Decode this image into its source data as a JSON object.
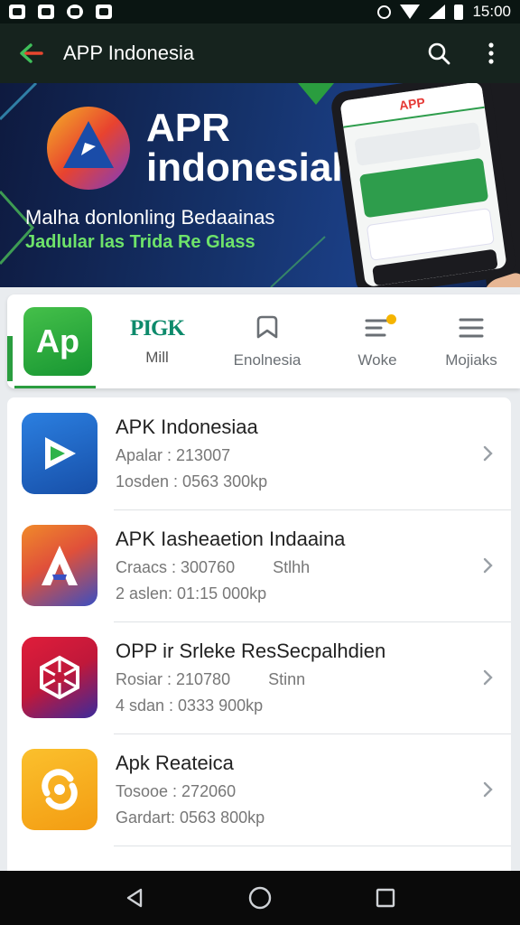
{
  "status_bar": {
    "time": "15:00"
  },
  "app_bar": {
    "title": "APP Indonesia"
  },
  "banner": {
    "title_line1": "APR",
    "title_line2": "indonesial",
    "subtitle": "Malha donlonling Bedaainas",
    "tagline": "Jadlular las Trida Re Glass",
    "phone_header": "APP",
    "colors": {
      "accent_green": "#6ee36a"
    }
  },
  "tabs": {
    "logo_text": "Ap",
    "items": [
      {
        "mark": "PIGK",
        "label": "Mill"
      },
      {
        "label": "Enolnesia",
        "icon": "bookmark-icon"
      },
      {
        "label": "Woke",
        "icon": "notes-icon"
      },
      {
        "label": "Mojiaks",
        "icon": "menu-icon"
      }
    ]
  },
  "apps": [
    {
      "title": "APK Indonesiaa",
      "line1": "Apalar : 213007",
      "line1_extra": "",
      "line2": "1osden : 0563 300kp",
      "icon": "play-icon",
      "color": "#1f5fbf"
    },
    {
      "title": "APK Iasheaetion Indaaina",
      "line1": "Craacs : 300760",
      "line1_extra": "Stlhh",
      "line2": "2 aslen: 01:15 000kp",
      "icon": "letter-a-icon",
      "color": "#e86a2f"
    },
    {
      "title": "OPP ir Srleke ResSecpalhdien",
      "line1": "Rosiar : 210780",
      "line1_extra": "Stinn",
      "line2": "4 sdan : 0333 900kp",
      "icon": "cube-icon",
      "color": "#c6173a"
    },
    {
      "title": "Apk Reateica",
      "line1": "Tosooe : 272060",
      "line1_extra": "",
      "line2": "Gardart: 0563 800kp",
      "icon": "sync-icon",
      "color": "#f5a821"
    }
  ]
}
